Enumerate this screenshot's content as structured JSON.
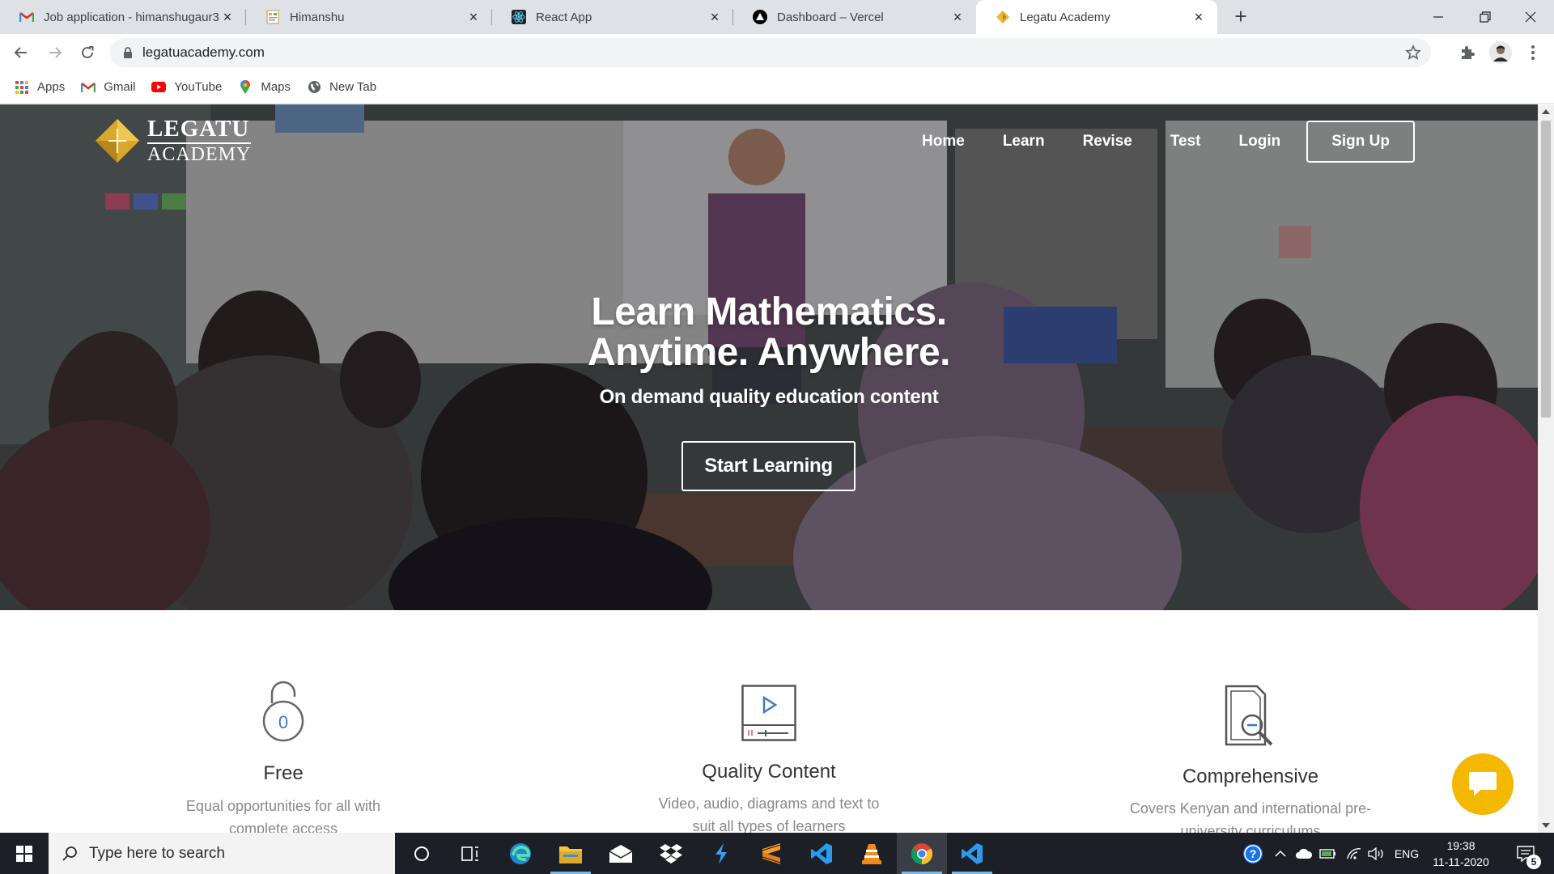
{
  "browser": {
    "tabs": [
      {
        "title": "Job application - himanshugaur3",
        "favicon": "gmail-icon",
        "active": false
      },
      {
        "title": "Himanshu",
        "favicon": "page-icon",
        "active": false
      },
      {
        "title": "React App",
        "favicon": "react-icon",
        "active": false
      },
      {
        "title": "Dashboard – Vercel",
        "favicon": "vercel-icon",
        "active": false
      },
      {
        "title": "Legatu Academy",
        "favicon": "legatu-icon",
        "active": true
      }
    ],
    "url": "legatuacademy.com",
    "bookmarks": [
      {
        "label": "Apps",
        "icon": "apps-grid-icon"
      },
      {
        "label": "Gmail",
        "icon": "gmail-icon"
      },
      {
        "label": "YouTube",
        "icon": "youtube-icon"
      },
      {
        "label": "Maps",
        "icon": "maps-icon"
      },
      {
        "label": "New Tab",
        "icon": "globe-icon"
      }
    ]
  },
  "site": {
    "logo": {
      "line1": "LEGATU",
      "line2": "ACADEMY"
    },
    "nav": [
      "Home",
      "Learn",
      "Revise",
      "Test",
      "Login"
    ],
    "signup": "Sign Up",
    "hero": {
      "line1": "Learn Mathematics.",
      "line2": "Anytime. Anywhere.",
      "subtitle": "On demand quality education content",
      "cta": "Start Learning"
    },
    "features": [
      {
        "icon": "unlocked-padlock-icon",
        "icon_text": "0",
        "title": "Free",
        "desc1": "Equal opportunities for all with",
        "desc2": "complete access"
      },
      {
        "icon": "video-player-icon",
        "title": "Quality Content",
        "desc1": "Video, audio, diagrams and text to",
        "desc2": "suit all types of learners"
      },
      {
        "icon": "document-search-icon",
        "title": "Comprehensive",
        "desc1": "Covers Kenyan and international pre-",
        "desc2": "university curriculums"
      }
    ],
    "accent_color": "#f5b800"
  },
  "taskbar": {
    "search_placeholder": "Type here to search",
    "time": "19:38",
    "date": "11-11-2020",
    "language": "ENG",
    "notification_count": "5"
  }
}
